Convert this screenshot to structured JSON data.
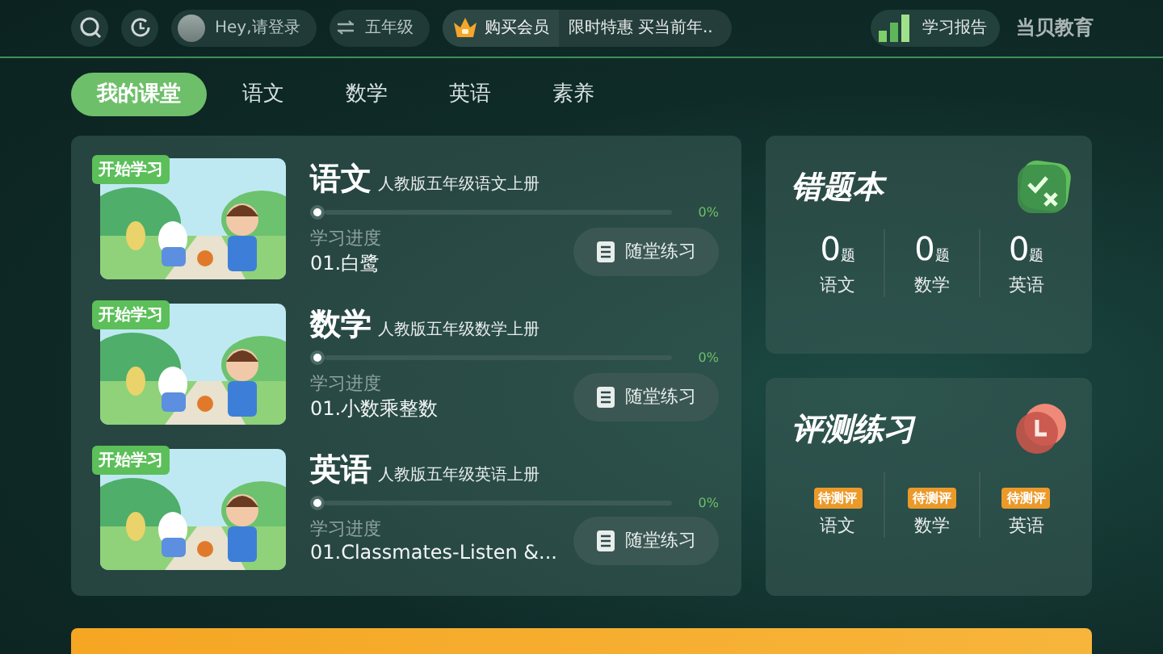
{
  "top_bar": {
    "login": "Hey,请登录",
    "grade": "五年级",
    "vip": "购买会员",
    "promo": "限时特惠 买当前年..",
    "report": "学习报告",
    "brand": "当贝教育"
  },
  "tabs": [
    {
      "label": "我的课堂",
      "selected": true
    },
    {
      "label": "语文",
      "selected": false
    },
    {
      "label": "数学",
      "selected": false
    },
    {
      "label": "英语",
      "selected": false
    },
    {
      "label": "素养",
      "selected": false
    }
  ],
  "courses": [
    {
      "badge": "开始学习",
      "subject": "语文",
      "book": "人教版五年级语文上册",
      "level": 0,
      "percent": "0%",
      "progress_label": "学习进度",
      "lesson": "01.白鹭",
      "button": "随堂练习"
    },
    {
      "badge": "开始学习",
      "subject": "数学",
      "book": "人教版五年级数学上册",
      "level": 0,
      "percent": "0%",
      "progress_label": "学习进度",
      "lesson": "01.小数乘整数",
      "button": "随堂练习"
    },
    {
      "badge": "开始学习",
      "subject": "英语",
      "book": "人教版五年级英语上册",
      "level": 0,
      "percent": "0%",
      "progress_label": "学习进度",
      "lesson": "01.Classmates-Listen &...",
      "button": "随堂练习"
    }
  ],
  "mistakes": {
    "title": "错题本",
    "items": [
      {
        "count": "0",
        "unit": "题",
        "subject": "语文"
      },
      {
        "count": "0",
        "unit": "题",
        "subject": "数学"
      },
      {
        "count": "0",
        "unit": "题",
        "subject": "英语"
      }
    ]
  },
  "assessment": {
    "title": "评测练习",
    "items": [
      {
        "status": "待测评",
        "subject": "语文"
      },
      {
        "status": "待测评",
        "subject": "数学"
      },
      {
        "status": "待测评",
        "subject": "英语"
      }
    ]
  }
}
